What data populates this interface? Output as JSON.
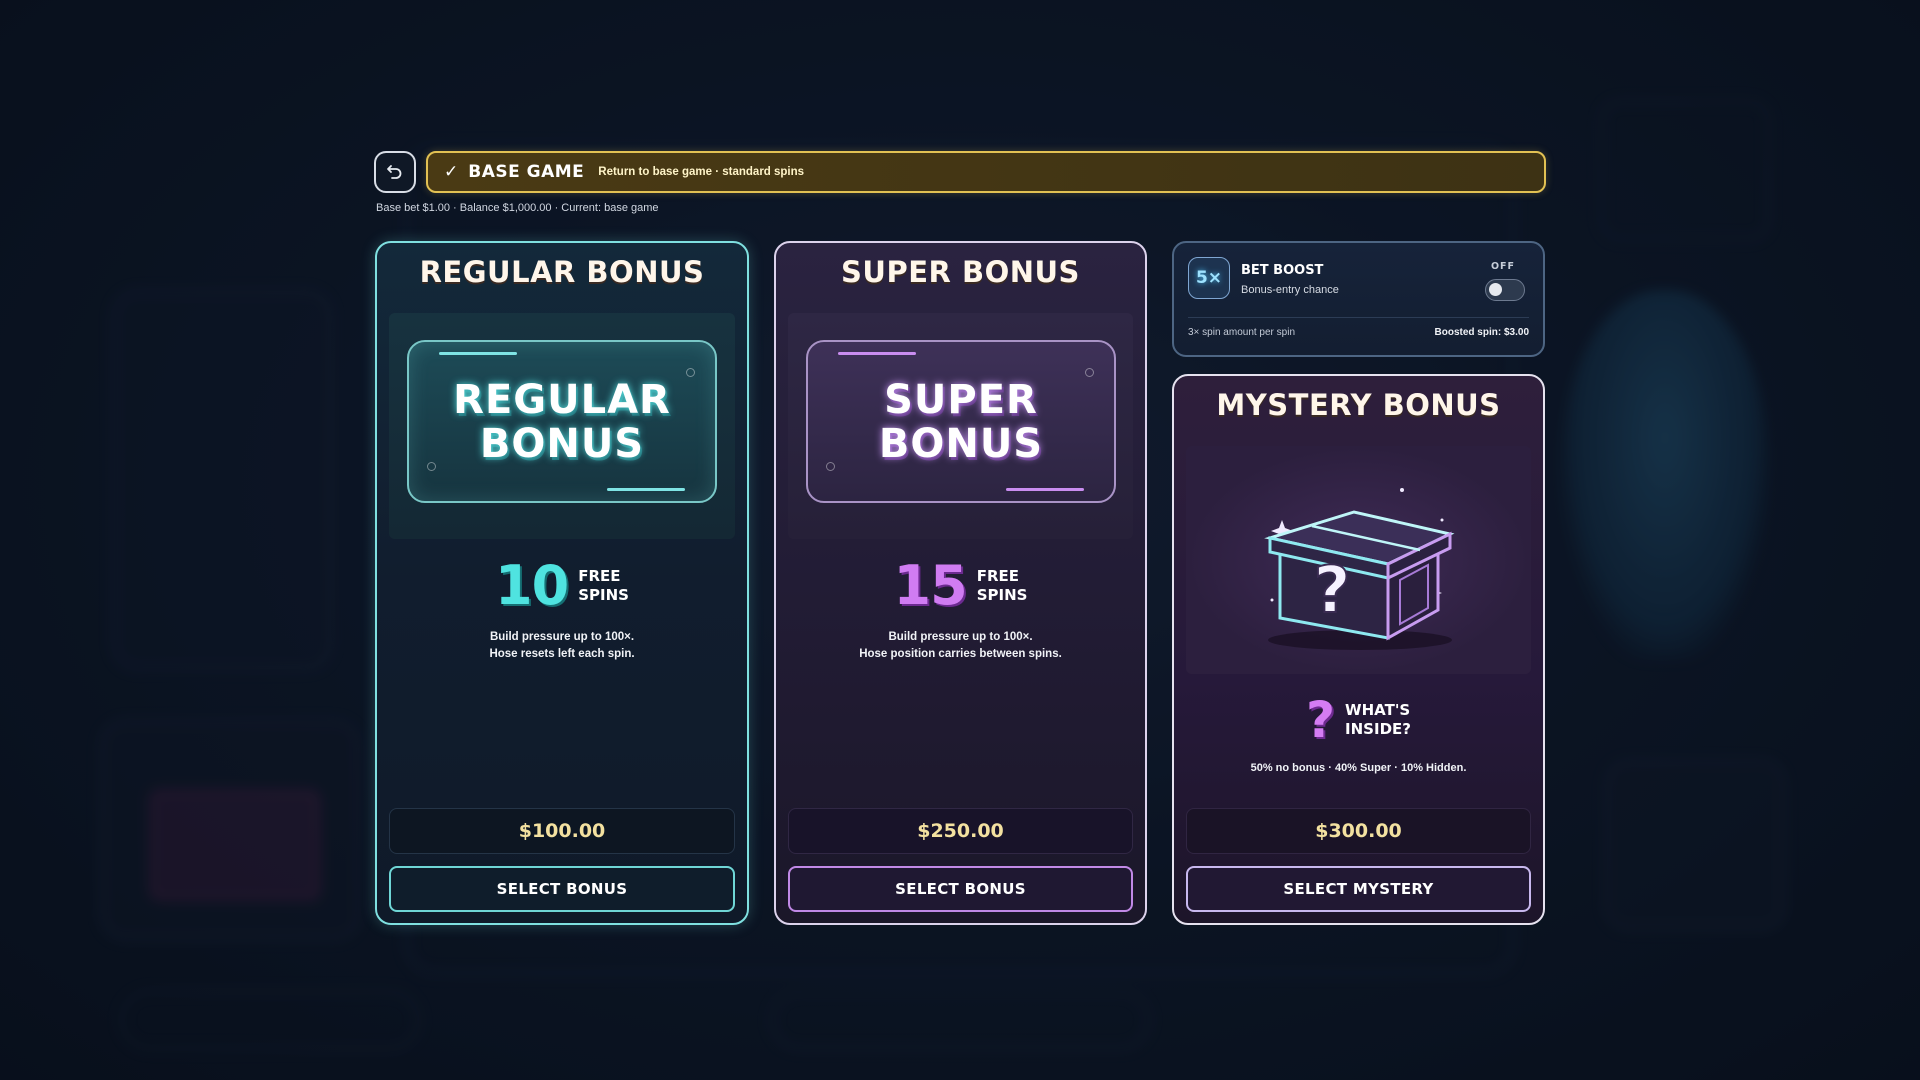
{
  "top_bar": {
    "back_icon": "undo-arrow-icon",
    "check": "✓",
    "mode_title": "BASE GAME",
    "mode_desc": "Return to base game · standard spins",
    "status": "Base bet $1.00 · Balance $1,000.00 · Current: base game"
  },
  "cards": {
    "regular": {
      "title": "REGULAR BONUS",
      "logo_line1": "REGULAR",
      "logo_line2": "BONUS",
      "spins_count": "10",
      "spins_line1": "FREE",
      "spins_line2": "SPINS",
      "desc_line1": "Build pressure up to 100×.",
      "desc_line2": "Hose resets left each spin.",
      "price": "$100.00",
      "button": "SELECT BONUS"
    },
    "super": {
      "title": "SUPER BONUS",
      "logo_line1": "SUPER",
      "logo_line2": "BONUS",
      "spins_count": "15",
      "spins_line1": "FREE",
      "spins_line2": "SPINS",
      "desc_line1": "Build pressure up to 100×.",
      "desc_line2": "Hose position carries between spins.",
      "price": "$250.00",
      "button": "SELECT BONUS"
    },
    "mystery": {
      "title": "MYSTERY BONUS",
      "q_mark": "?",
      "label_line1": "WHAT'S",
      "label_line2": "INSIDE?",
      "odds": "50% no bonus · 40% Super · 10% Hidden.",
      "price": "$300.00",
      "button": "SELECT MYSTERY"
    }
  },
  "bet_boost": {
    "badge": "5×",
    "title": "BET BOOST",
    "subtitle": "Bonus-entry chance",
    "state": "OFF",
    "toggle_on": false,
    "footer_left": "3× spin amount per spin",
    "footer_right": "Boosted spin: $3.00"
  },
  "colors": {
    "base_accent": "#e2c153",
    "regular_accent": "#4fe3e0",
    "super_accent": "#d07cf2",
    "price_text": "#f3e1a0"
  }
}
